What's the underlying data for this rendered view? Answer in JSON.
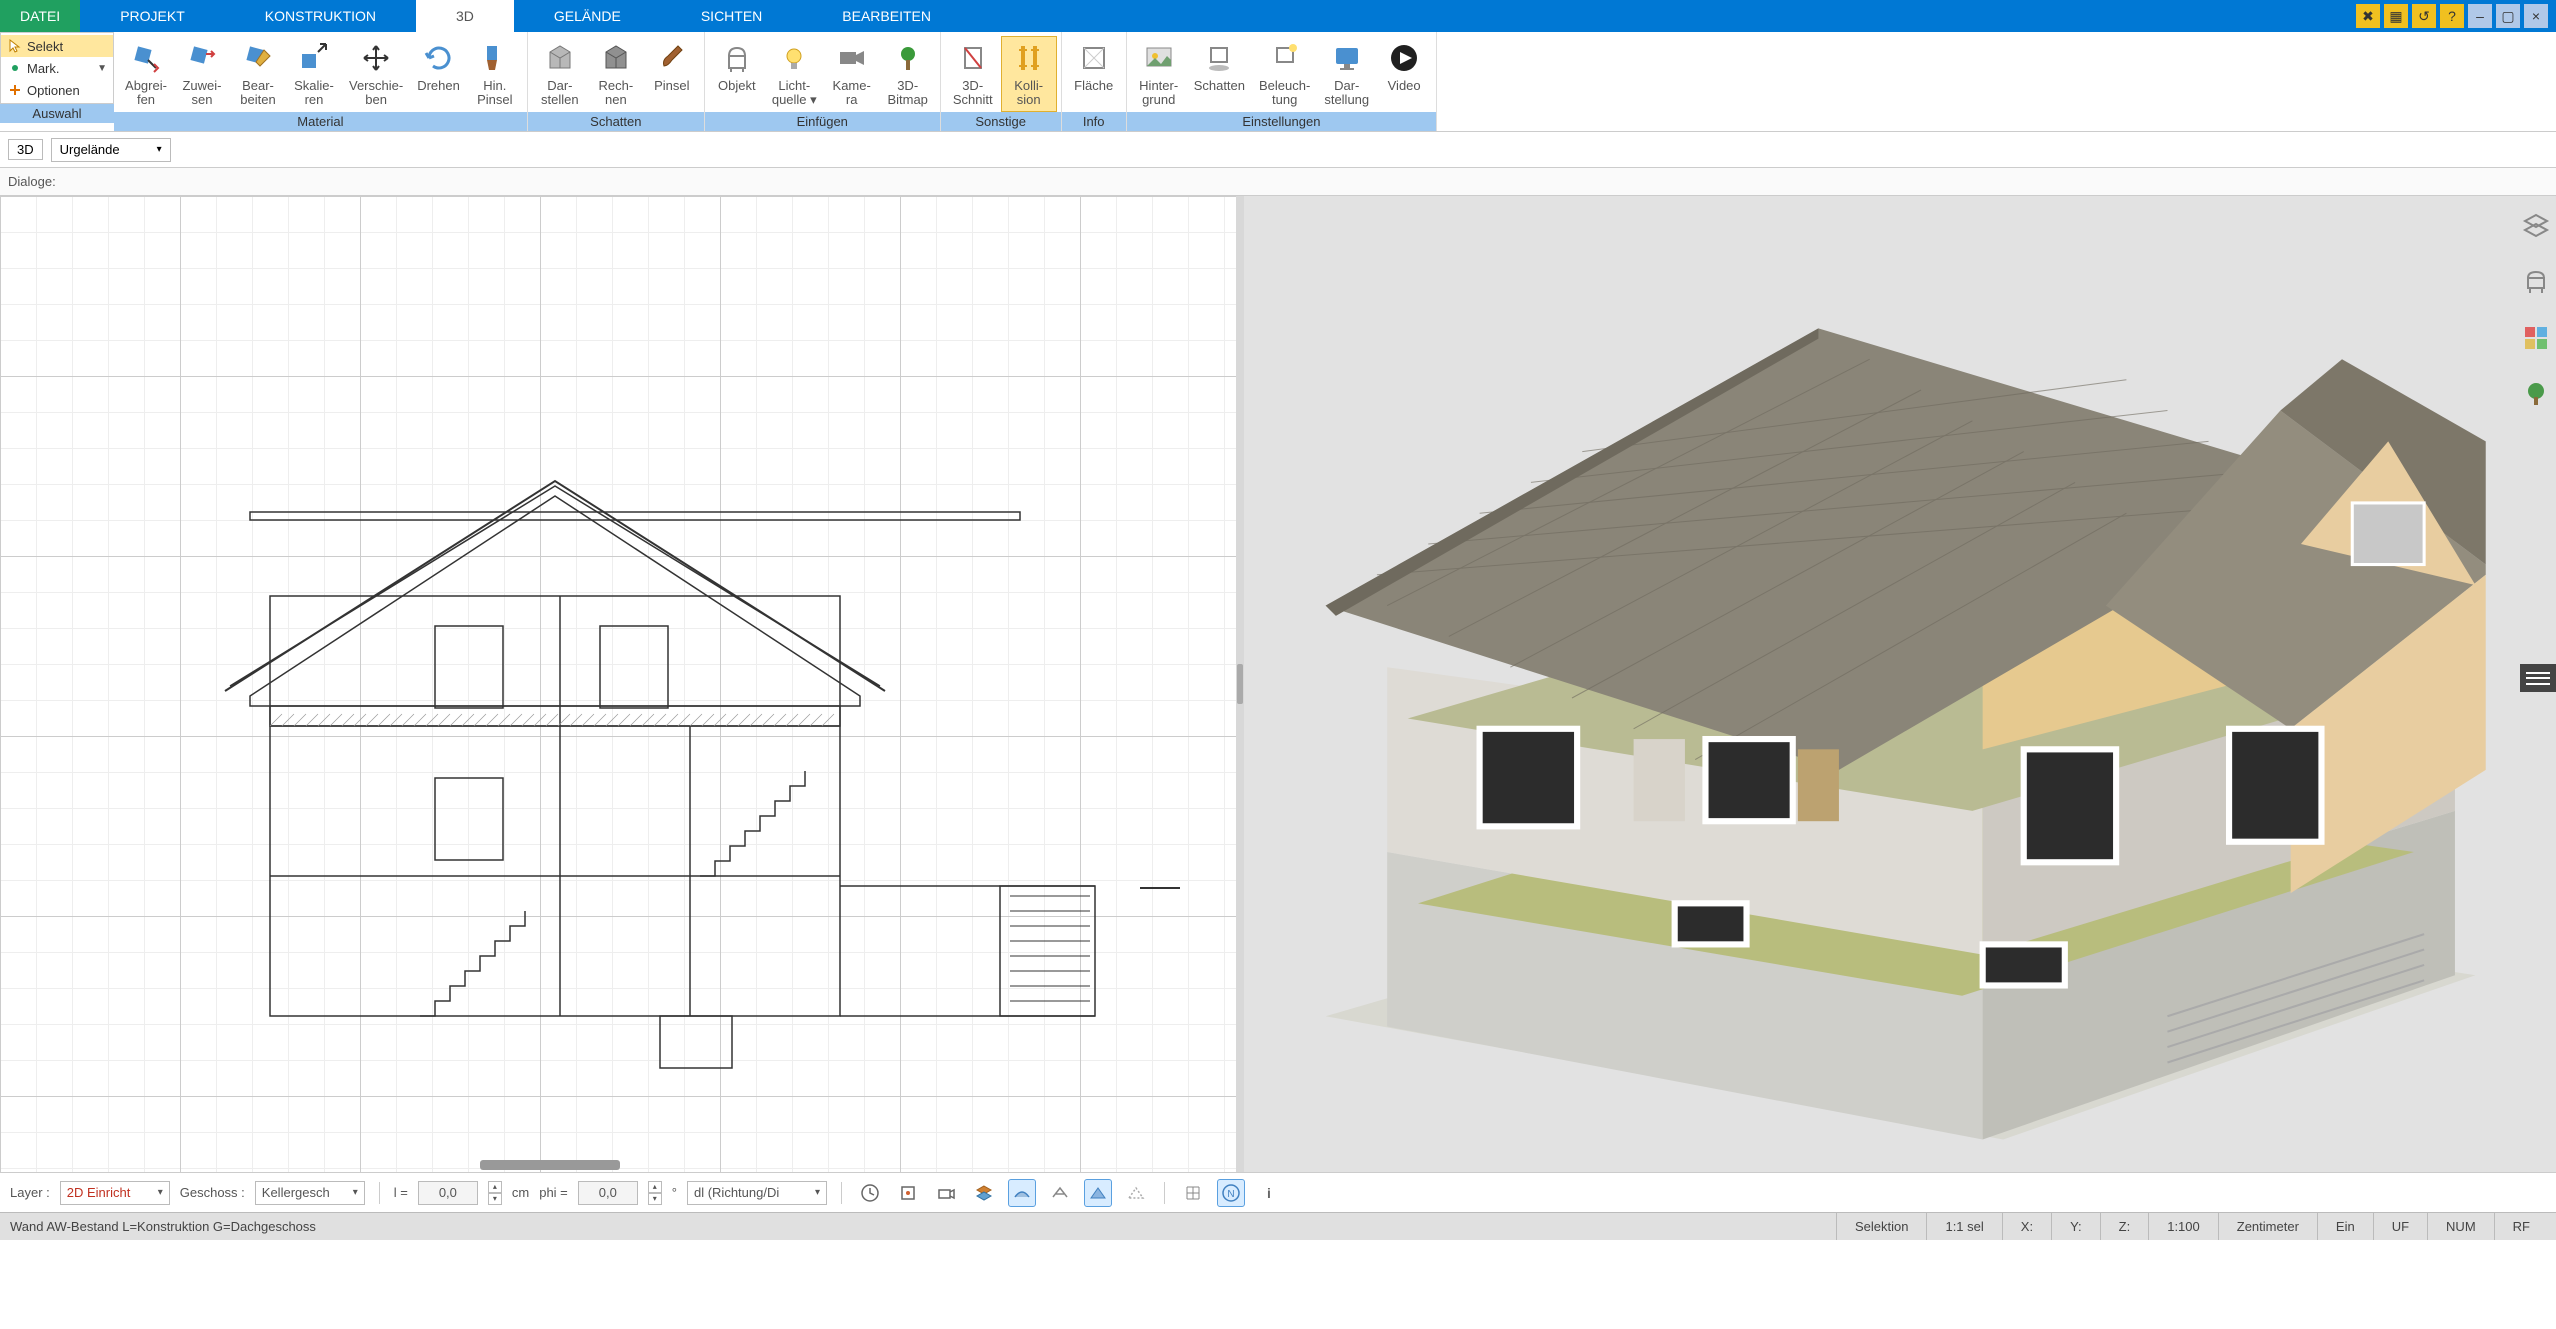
{
  "menu": {
    "items": [
      "DATEI",
      "PROJEKT",
      "KONSTRUKTION",
      "3D",
      "GELÄNDE",
      "SICHTEN",
      "BEARBEITEN"
    ],
    "active": "3D"
  },
  "auswahl": {
    "selekt": "Selekt",
    "mark": "Mark.",
    "optionen": "Optionen",
    "group": "Auswahl"
  },
  "ribbon": {
    "groups": [
      {
        "label": "Material",
        "buttons": [
          {
            "key": "abgreifen",
            "l1": "Abgrei-",
            "l2": "fen"
          },
          {
            "key": "zuweisen",
            "l1": "Zuwei-",
            "l2": "sen"
          },
          {
            "key": "bearbeiten",
            "l1": "Bear-",
            "l2": "beiten"
          },
          {
            "key": "skalieren",
            "l1": "Skalie-",
            "l2": "ren"
          },
          {
            "key": "verschieben",
            "l1": "Verschie-",
            "l2": "ben"
          },
          {
            "key": "drehen",
            "l1": "Drehen",
            "l2": ""
          },
          {
            "key": "hinpinsel",
            "l1": "Hin.",
            "l2": "Pinsel"
          }
        ]
      },
      {
        "label": "Schatten",
        "buttons": [
          {
            "key": "darstellen",
            "l1": "Dar-",
            "l2": "stellen"
          },
          {
            "key": "rechnen",
            "l1": "Rech-",
            "l2": "nen"
          },
          {
            "key": "pinsel",
            "l1": "Pinsel",
            "l2": ""
          }
        ]
      },
      {
        "label": "Einfügen",
        "buttons": [
          {
            "key": "objekt",
            "l1": "Objekt",
            "l2": ""
          },
          {
            "key": "lichtquelle",
            "l1": "Licht-",
            "l2": "quelle ▾"
          },
          {
            "key": "kamera",
            "l1": "Kame-",
            "l2": "ra"
          },
          {
            "key": "bitmap3d",
            "l1": "3D-",
            "l2": "Bitmap"
          }
        ]
      },
      {
        "label": "Sonstige",
        "buttons": [
          {
            "key": "schnitt3d",
            "l1": "3D-",
            "l2": "Schnitt"
          },
          {
            "key": "kollision",
            "l1": "Kolli-",
            "l2": "sion",
            "active": true
          }
        ]
      },
      {
        "label": "Info",
        "buttons": [
          {
            "key": "flaeche",
            "l1": "Fläche",
            "l2": ""
          }
        ]
      },
      {
        "label": "Einstellungen",
        "buttons": [
          {
            "key": "hintergrund",
            "l1": "Hinter-",
            "l2": "grund"
          },
          {
            "key": "schatten",
            "l1": "Schatten",
            "l2": ""
          },
          {
            "key": "beleuchtung",
            "l1": "Beleuch-",
            "l2": "tung"
          },
          {
            "key": "darstellung",
            "l1": "Dar-",
            "l2": "stellung"
          },
          {
            "key": "video",
            "l1": "Video",
            "l2": ""
          }
        ]
      }
    ]
  },
  "subtoolbar": {
    "mode": "3D",
    "terrain": "Urgelände"
  },
  "dialoge_label": "Dialoge:",
  "bottom": {
    "layer_label": "Layer :",
    "layer_value": "2D Einricht",
    "geschoss_label": "Geschoss :",
    "geschoss_value": "Kellergesch",
    "l_label": "l =",
    "l_value": "0,0",
    "l_unit": "cm",
    "phi_label": "phi =",
    "phi_value": "0,0",
    "phi_unit": "°",
    "dl_value": "dl (Richtung/Di"
  },
  "status": {
    "left": "Wand AW-Bestand L=Konstruktion G=Dachgeschoss",
    "selektion": "Selektion",
    "ratio": "1:1 sel",
    "x": "X:",
    "y": "Y:",
    "z": "Z:",
    "scale": "1:100",
    "unit": "Zentimeter",
    "ein": "Ein",
    "uf": "UF",
    "num": "NUM",
    "rf": "RF"
  }
}
